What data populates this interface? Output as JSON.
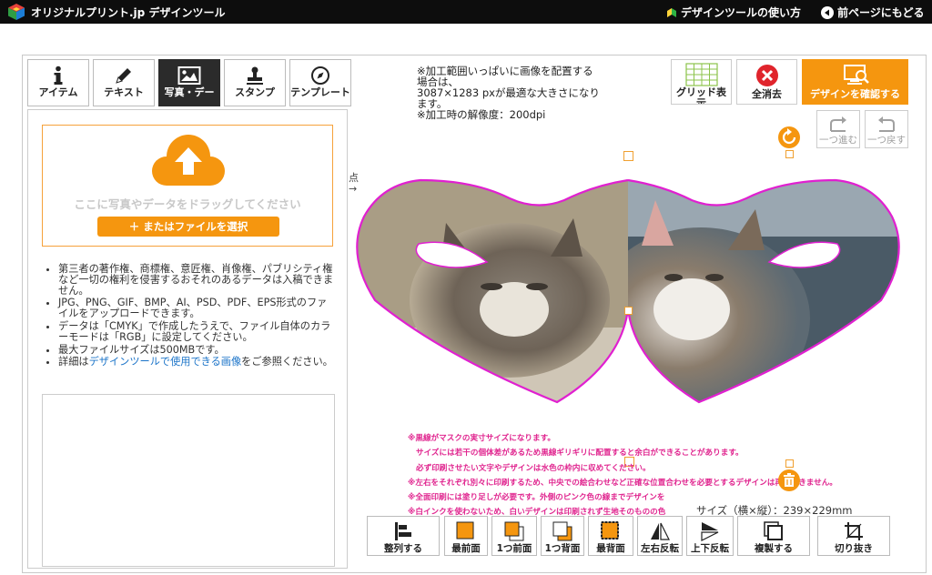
{
  "header": {
    "brand": "オリジナルプリント.jp デザインツール",
    "guide_link": "デザインツールの使い方",
    "back_link": "前ページにもどる"
  },
  "tool_tabs": [
    {
      "label": "アイテム",
      "icon": "info-icon"
    },
    {
      "label": "テキスト",
      "icon": "pen-icon"
    },
    {
      "label": "写真・デー",
      "icon": "image-icon"
    },
    {
      "label": "スタンプ",
      "icon": "stamp-icon"
    },
    {
      "label": "テンプレート",
      "icon": "compass-icon"
    }
  ],
  "upload": {
    "drag_text": "ここに写真やデータをドラッグしてください",
    "file_button": "＋ またはファイルを選択"
  },
  "notes": [
    "第三者の著作権、商標権、意匠権、肖像権、パブリシティ権など一切の権利を侵害するおそれのあるデータは入稿できません。",
    "JPG、PNG、GIF、BMP、AI、PSD、PDF、EPS形式のファイルをアップロードできます。",
    "データは「CMYK」で作成したうえで、ファイル自体のカラーモードは「RGB」に設定してください。",
    "最大ファイルサイズは500MBです。"
  ],
  "notes_last": {
    "prefix": "詳細は",
    "link": "デザインツールで使用できる画像",
    "suffix": "をご参照ください。"
  },
  "canvas_info": {
    "line1": "※加工範囲いっぱいに画像を配置する",
    "line2": "場合は、",
    "line3": "3087×1283 pxが最適な大きさになり",
    "line4": "ます。",
    "line5": "※加工時の解像度：200dpi"
  },
  "top_buttons": {
    "grid": "グリッド表示",
    "clear": "全消去",
    "confirm": "デザインを確認する"
  },
  "history": {
    "redo": "一つ進む",
    "undo": "一つ戻す"
  },
  "origin_label": "点\n→",
  "warnings": [
    "※黒線がマスクの実寸サイズになります。",
    "サイズには若干の個体差があるため黒線ギリギリに配置すると余白ができることがあります。",
    "必ず印刷させたい文字やデザインは水色の枠内に収めてください。",
    "※左右をそれぞれ別々に印刷するため、中央での絵合わせなど正確な位置合わせを必要とするデザインは再現できません。",
    "※全面印刷には塗り足しが必要です。外側のピンク色の線までデザインを",
    "※白インクを使わないため、白いデザインは印刷されず生地そのものの色"
  ],
  "size_readout": "サイズ（横×縦）：239×229mm",
  "bottom_toolbar": [
    {
      "label": "整列する",
      "icon": "align-icon"
    },
    {
      "label": "最前面",
      "icon": "bring-front-icon"
    },
    {
      "label": "1つ前面",
      "icon": "bring-forward-icon"
    },
    {
      "label": "1つ背面",
      "icon": "send-backward-icon"
    },
    {
      "label": "最背面",
      "icon": "send-back-icon"
    },
    {
      "label": "左右反転",
      "icon": "flip-horizontal-icon"
    },
    {
      "label": "上下反転",
      "icon": "flip-vertical-icon"
    },
    {
      "label": "複製する",
      "icon": "duplicate-icon"
    },
    {
      "label": "切り抜き",
      "icon": "crop-icon"
    }
  ],
  "colors": {
    "accent": "#f5960f",
    "mask_outline": "#e020d0",
    "warning_text": "#e0258f",
    "link": "#1a73c8"
  }
}
